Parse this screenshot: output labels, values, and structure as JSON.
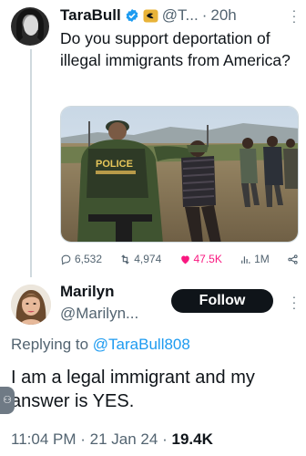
{
  "original_tweet": {
    "author_name": "TaraBull",
    "handle": "@T...",
    "separator": "·",
    "time": "20h",
    "text": "Do you support deportation of illegal immigrants from America?",
    "image_label": "POLICE",
    "actions": {
      "replies": "6,532",
      "retweets": "4,974",
      "likes": "47.5K",
      "views": "1M"
    }
  },
  "reply": {
    "author_name": "Marilyn",
    "handle": "@Marilyn...",
    "follow_label": "Follow",
    "replying_prefix": "Replying to",
    "replying_handle": "@TaraBull808",
    "text": "I am a legal immigrant and my answer is YES.",
    "time": "11:04 PM",
    "date": "21 Jan 24",
    "separator": "·",
    "views": "19.4K"
  },
  "colors": {
    "link": "#1d9bf0",
    "like": "#f91880",
    "muted": "#536471",
    "verified": "#1d9bf0",
    "gold": "#e8b339"
  },
  "icons": [
    "more-icon",
    "verified-badge-icon",
    "gold-affiliate-icon",
    "reply-icon",
    "retweet-icon",
    "like-icon",
    "views-icon",
    "share-icon",
    "accessibility-icon"
  ]
}
